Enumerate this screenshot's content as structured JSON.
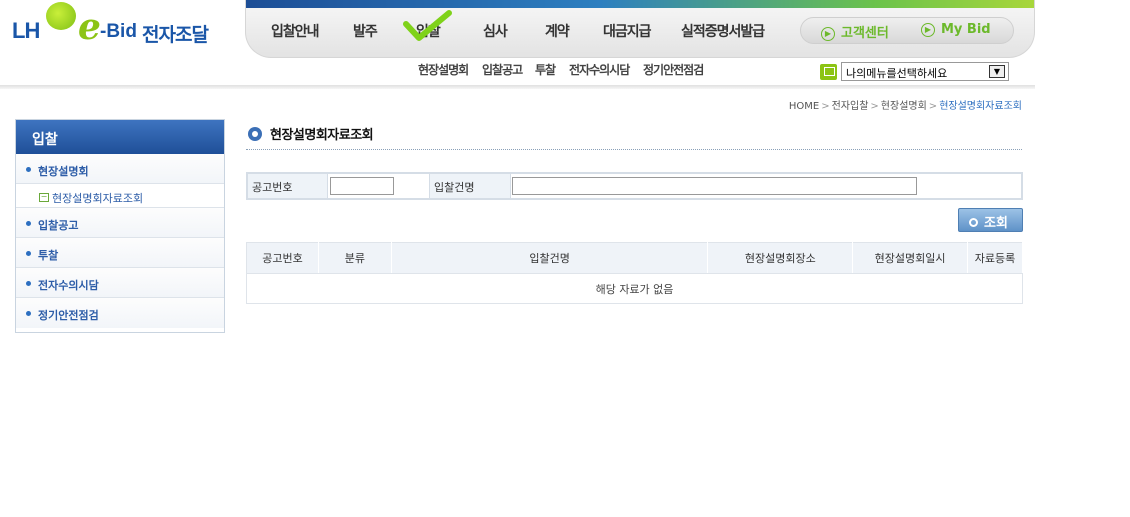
{
  "logo": {
    "lh": "LH",
    "e": "e",
    "bid": "-Bid",
    "kr": "전자조달"
  },
  "gnb": {
    "items": [
      "입찰안내",
      "발주",
      "입찰",
      "심사",
      "계약",
      "대금지급",
      "실적증명서발급"
    ],
    "customer_center": "고객센터",
    "my_bid": "My Bid"
  },
  "sub_nav": [
    "현장설명회",
    "입찰공고",
    "투찰",
    "전자수의시담",
    "정기안전점검"
  ],
  "my_menu": {
    "selected": "나의메뉴를선택하세요"
  },
  "breadcrumb": [
    "HOME",
    "전자입찰",
    "현장설명회",
    "현장설명회자료조회"
  ],
  "lnb": {
    "title": "입찰",
    "items": [
      {
        "label": "현장설명회"
      },
      {
        "label": "현장설명회자료조회"
      },
      {
        "label": "입찰공고"
      },
      {
        "label": "투찰"
      },
      {
        "label": "전자수의시담"
      },
      {
        "label": "정기안전점검"
      }
    ]
  },
  "page_title": "현장설명회자료조회",
  "search": {
    "notice_no_label": "공고번호",
    "notice_no_value": "",
    "bid_name_label": "입찰건명",
    "bid_name_value": "",
    "button_label": "조회"
  },
  "table": {
    "headers": [
      "공고번호",
      "분류",
      "입찰건명",
      "현장설명회장소",
      "현장설명회일시",
      "자료등록"
    ],
    "empty_message": "해당 자료가 없음"
  },
  "colors": {
    "brand_blue": "#1a56a8",
    "brand_green": "#8cc414",
    "accent_blue": "#2d6fc0"
  }
}
